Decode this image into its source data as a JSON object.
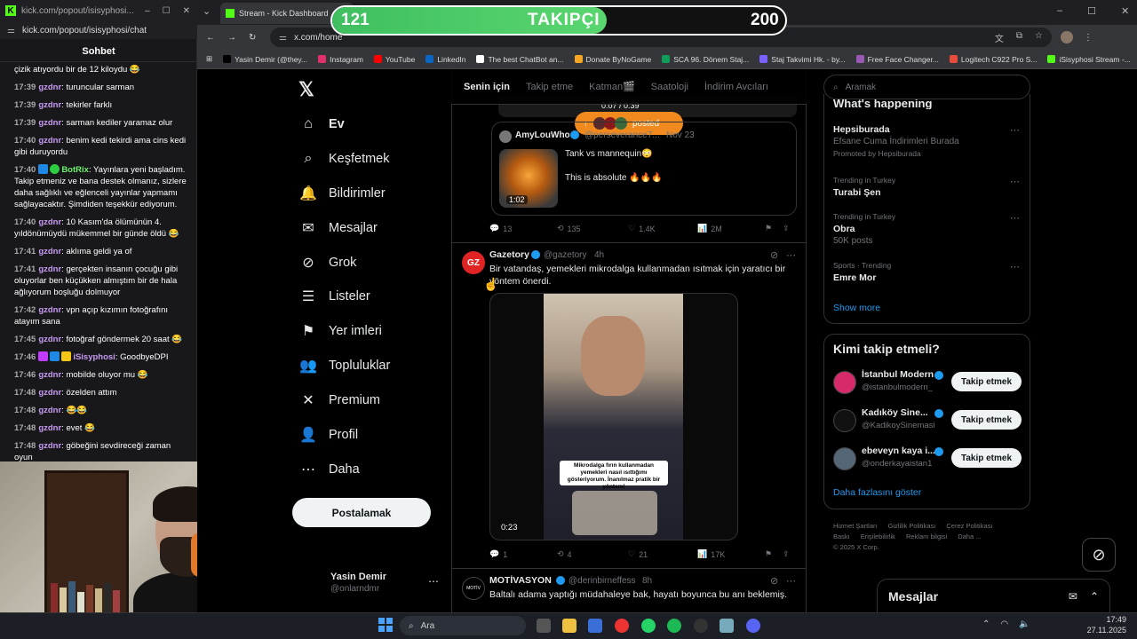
{
  "chat_window": {
    "titlebar_url": "kick.com/popout/isisyphosi...",
    "address_url": "kick.com/popout/isisyphosi/chat",
    "header_title": "Sohbet",
    "messages": [
      {
        "time": "",
        "user": "",
        "text": "çizik atıyordu bir de 12 kiloydu 😂"
      },
      {
        "time": "17:39",
        "user": "gzdnr",
        "text": "turuncular sarman"
      },
      {
        "time": "17:39",
        "user": "gzdnr",
        "text": "tekirler farklı"
      },
      {
        "time": "17:39",
        "user": "gzdnr",
        "text": "sarman kediler yaramaz olur"
      },
      {
        "time": "17:40",
        "user": "gzdnr",
        "text": "benim kedi tekirdi ama cins kedi gibi duruyordu"
      },
      {
        "time": "17:40",
        "user": "BotRix",
        "bot": true,
        "text": "Yayınlara yeni başladım. Takip etmeniz ve bana destek olmanız, sizlere daha sağlıklı ve eğlenceli yayınlar yapmamı sağlayacaktır. Şimdiden teşekkür ediyorum."
      },
      {
        "time": "17:40",
        "user": "gzdnr",
        "text": "10 Kasım'da ölümünün 4. yıldönümüydü mükemmel bir günde öldü 😂"
      },
      {
        "time": "17:41",
        "user": "gzdnr",
        "text": "aklıma geldi ya of"
      },
      {
        "time": "17:41",
        "user": "gzdnr",
        "text": "gerçekten insanın çocuğu gibi oluyorlar ben küçükken almıştım bir de hala ağlıyorum boşluğu dolmuyor"
      },
      {
        "time": "17:42",
        "user": "gzdnr",
        "text": "vpn açıp kızımın fotoğrafını atayım sana"
      },
      {
        "time": "17:45",
        "user": "gzdnr",
        "text": "fotoğraf göndermek 20 saat 😂"
      },
      {
        "time": "17:46",
        "user": "iSisyphosi",
        "streamer": true,
        "text": "GoodbyeDPI"
      },
      {
        "time": "17:46",
        "user": "gzdnr",
        "text": "mobilde oluyor mu 😂"
      },
      {
        "time": "17:48",
        "user": "gzdnr",
        "text": "özelden attım"
      },
      {
        "time": "17:48",
        "user": "gzdnr",
        "text": "😂😂"
      },
      {
        "time": "17:48",
        "user": "gzdnr",
        "text": "evet 😂"
      },
      {
        "time": "17:48",
        "user": "gzdnr",
        "text": "göbeğini sevdireceği zaman oyun"
      }
    ]
  },
  "browser": {
    "tab_title": "Stream - Kick Dashboard",
    "address": "x.com/home",
    "bookmarks": [
      {
        "label": "Yasin Demir (@they...",
        "color": "#000000"
      },
      {
        "label": "Instagram",
        "color": "#e1306c"
      },
      {
        "label": "YouTube",
        "color": "#ff0000"
      },
      {
        "label": "LinkedIn",
        "color": "#0a66c2"
      },
      {
        "label": "The best ChatBot an...",
        "color": "#ffffff"
      },
      {
        "label": "Donate ByNoGame",
        "color": "#f5a623"
      },
      {
        "label": "SCA 96. Dönem Staj...",
        "color": "#0f9d58"
      },
      {
        "label": "Staj Takvimi Hk. - by...",
        "color": "#7b61ff"
      },
      {
        "label": "Free Face Changer...",
        "color": "#9b59b6"
      },
      {
        "label": "Logitech C922 Pro S...",
        "color": "#e74c3c"
      },
      {
        "label": "iSisyphosi Stream -...",
        "color": "#53fc18"
      }
    ]
  },
  "follower_goal": {
    "current": "121",
    "label": "TAKIPÇI",
    "goal": "200",
    "fill_fraction": 0.605,
    "color": "#3fbf60"
  },
  "x_nav": {
    "items": [
      {
        "label": "Ev",
        "icon": "home-icon",
        "glyph": "⌂"
      },
      {
        "label": "Keşfetmek",
        "icon": "search-icon",
        "glyph": "⌕"
      },
      {
        "label": "Bildirimler",
        "icon": "bell-icon",
        "glyph": "🔔"
      },
      {
        "label": "Mesajlar",
        "icon": "mail-icon",
        "glyph": "✉"
      },
      {
        "label": "Grok",
        "icon": "grok-icon",
        "glyph": "⊘"
      },
      {
        "label": "Listeler",
        "icon": "list-icon",
        "glyph": "☰"
      },
      {
        "label": "Yer imleri",
        "icon": "bookmark-icon",
        "glyph": "⚑"
      },
      {
        "label": "Topluluklar",
        "icon": "people-icon",
        "glyph": "👥"
      },
      {
        "label": "Premium",
        "icon": "x-logo-icon",
        "glyph": "✕"
      },
      {
        "label": "Profil",
        "icon": "person-icon",
        "glyph": "👤"
      },
      {
        "label": "Daha",
        "icon": "more-icon",
        "glyph": "⋯"
      }
    ],
    "post_button": "Postalamak",
    "profile_name": "Yasin Demir",
    "profile_handle": "@onlarndmr"
  },
  "feed": {
    "tabs": [
      "Senin için",
      "Takip etme",
      "Katman🎬",
      "Saatoloji",
      "İndirim Avcıları"
    ],
    "posted_pill": "posted",
    "video_time_top": "0:07 / 0:39",
    "quote": {
      "name": "AmyLouWho",
      "handle": "@perseverance7...",
      "date": "Nov 23",
      "line1": "Tank vs mannequin😳",
      "line2": "This is absolute 🔥🔥🔥",
      "thumb_time": "1:02"
    },
    "post1_actions": {
      "replies": "13",
      "reposts": "135",
      "likes": "1.4K",
      "views": "2M"
    },
    "post2": {
      "avatar_text": "GZ",
      "name": "Gazetory",
      "handle": "@gazetory",
      "age": "4h",
      "text": "Bir vatandaş, yemekleri mikrodalga kullanmadan ısıtmak için yaratıcı bir yöntem önerdi.",
      "caption": "Mikrodalga fırın kullanmadan yemekleri nasıl ısıttığımı gösteriyorum. İnanılmaz pratik bir yöntem!",
      "duration": "0:23",
      "actions": {
        "replies": "1",
        "reposts": "4",
        "likes": "21",
        "views": "17K"
      }
    },
    "post3": {
      "name": "MOTİVASYON",
      "handle": "@derinbirneffess",
      "age": "8h",
      "text": "Baltalı adama yaptığı müdahaleye bak, hayatı boyunca bu anı beklemiş."
    }
  },
  "right": {
    "search_placeholder": "Aramak",
    "trends_title": "What's happening",
    "trends": [
      {
        "context": "",
        "name": "Hepsiburada",
        "sub": "Efsane Cuma İndirimleri Burada",
        "promoted": "Promoted by Hepsiburada"
      },
      {
        "context": "Trending in Turkey",
        "name": "Turabi Şen",
        "sub": "",
        "promoted": ""
      },
      {
        "context": "Trending in Turkey",
        "name": "Obra",
        "sub": "50K posts",
        "promoted": ""
      },
      {
        "context": "Sports · Trending",
        "name": "Emre Mor",
        "sub": "",
        "promoted": ""
      }
    ],
    "show_more": "Show more",
    "who_title": "Kimi takip etmeli?",
    "who": [
      {
        "name": "İstanbul Modern",
        "handle": "@istanbulmodern_",
        "button": "Takip etmek"
      },
      {
        "name": "Kadıköy Sine...",
        "handle": "@KadikoySinemasi",
        "button": "Takip etmek"
      },
      {
        "name": "ebeveyn kaya i...",
        "handle": "@onderkayaistan1",
        "button": "Takip etmek"
      }
    ],
    "more_link": "Daha fazlasını göster",
    "footer": [
      "Hizmet Şartları",
      "Gizlilik Politikası",
      "Çerez Politikası",
      "Baskı",
      "Erişilebilirlik",
      "Reklam bilgisi",
      "Daha ...",
      "© 2025 X Corp."
    ],
    "dm_title": "Mesajlar"
  },
  "taskbar": {
    "search": "Ara",
    "time": "17:49",
    "date": "27.11.2025"
  }
}
